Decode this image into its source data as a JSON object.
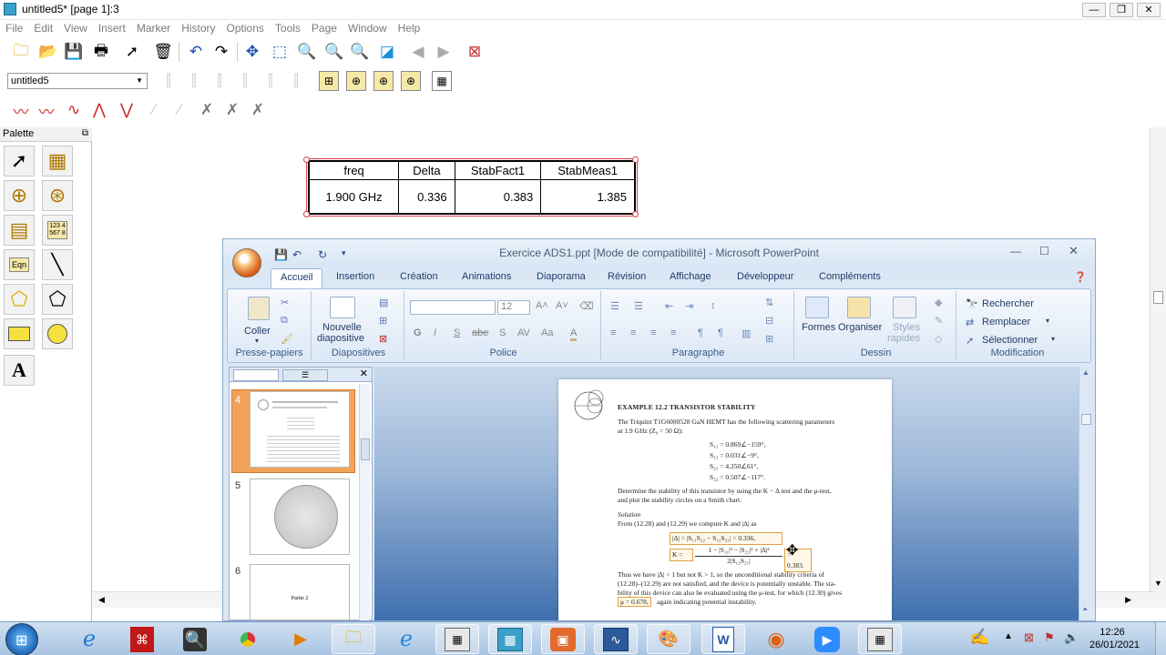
{
  "ads": {
    "title": "untitled5* [page 1]:3",
    "menu": [
      "File",
      "Edit",
      "View",
      "Insert",
      "Marker",
      "History",
      "Options",
      "Tools",
      "Page",
      "Window",
      "Help"
    ],
    "dropdown_value": "untitled5",
    "palette_title": "Palette",
    "palette_eqn_label": "Eqn",
    "palette_table_label": "123 4\n567 8",
    "palette_text_label": "A",
    "data_table": {
      "headers": [
        "freq",
        "Delta",
        "StabFact1",
        "StabMeas1"
      ],
      "row": [
        "1.900 GHz",
        "0.336",
        "0.383",
        "1.385"
      ]
    }
  },
  "ppt": {
    "title": "Exercice ADS1.ppt [Mode de compatibilité] - Microsoft PowerPoint",
    "tabs": [
      "Accueil",
      "Insertion",
      "Création",
      "Animations",
      "Diaporama",
      "Révision",
      "Affichage",
      "Développeur",
      "Compléments"
    ],
    "ribbon": {
      "paste": "Coller",
      "clipboard_group": "Presse-papiers",
      "new_slide_1": "Nouvelle",
      "new_slide_2": "diapositive",
      "slides_group": "Diapositives",
      "font_size": "12",
      "font_group": "Police",
      "paragraph_group": "Paragraphe",
      "shapes": "Formes",
      "arrange": "Organiser",
      "quick_styles_1": "Styles",
      "quick_styles_2": "rapides",
      "drawing_group": "Dessin",
      "find": "Rechercher",
      "replace": "Remplacer",
      "select": "Sélectionner",
      "editing_group": "Modification"
    },
    "thumbnails": [
      {
        "num": "4",
        "text": ""
      },
      {
        "num": "5",
        "text": ""
      },
      {
        "num": "6",
        "text": "Partie 2"
      }
    ],
    "slide": {
      "heading": "EXAMPLE 12.2    TRANSISTOR STABILITY",
      "intro_1": "The Triquint T1G6000528 GaN HEMT has the following scattering parameters",
      "intro_2": "at 1.9 GHz (Z₀ = 50 Ω):",
      "s11": "S₁₁ = 0.869∠−159°,",
      "s12": "S₁₂ = 0.031∠−9°,",
      "s21": "S₂₁ = 4.250∠61°,",
      "s22": "S₂₂ = 0.507∠−117°.",
      "task_1": "Determine the stability of this transistor by using the K − Δ test and the μ-test,",
      "task_2": "and plot the stability circles on a Smith chart.",
      "solution": "Solution",
      "from": "From (12.28) and (12.29) we compute K and |Δ| as",
      "delta_eq": "|Δ| = |S₁₁S₂₂ − S₁₂S₂₁| = 0.336,",
      "k_lhs": "K =",
      "k_num": "1 − |S₁₁|² − |S₂₂|² + |Δ|²",
      "k_den": "2|S₁₂S₂₁|",
      "k_val": "= 0.383.",
      "concl_1": "Thus we have |Δ| < 1 but not K > 1, so the unconditional stability criteria of",
      "concl_2": "(12.28)–(12.29) are not satisfied, and the device is potentially unstable. The sta-",
      "concl_3": "bility of this device can also be evaluated using the μ-test, for which (12.30) gives",
      "concl_4a": "μ = 0.678,",
      "concl_4b": "again indicating potential instability."
    }
  },
  "taskbar": {
    "time": "12:26",
    "date": "26/01/2021"
  }
}
